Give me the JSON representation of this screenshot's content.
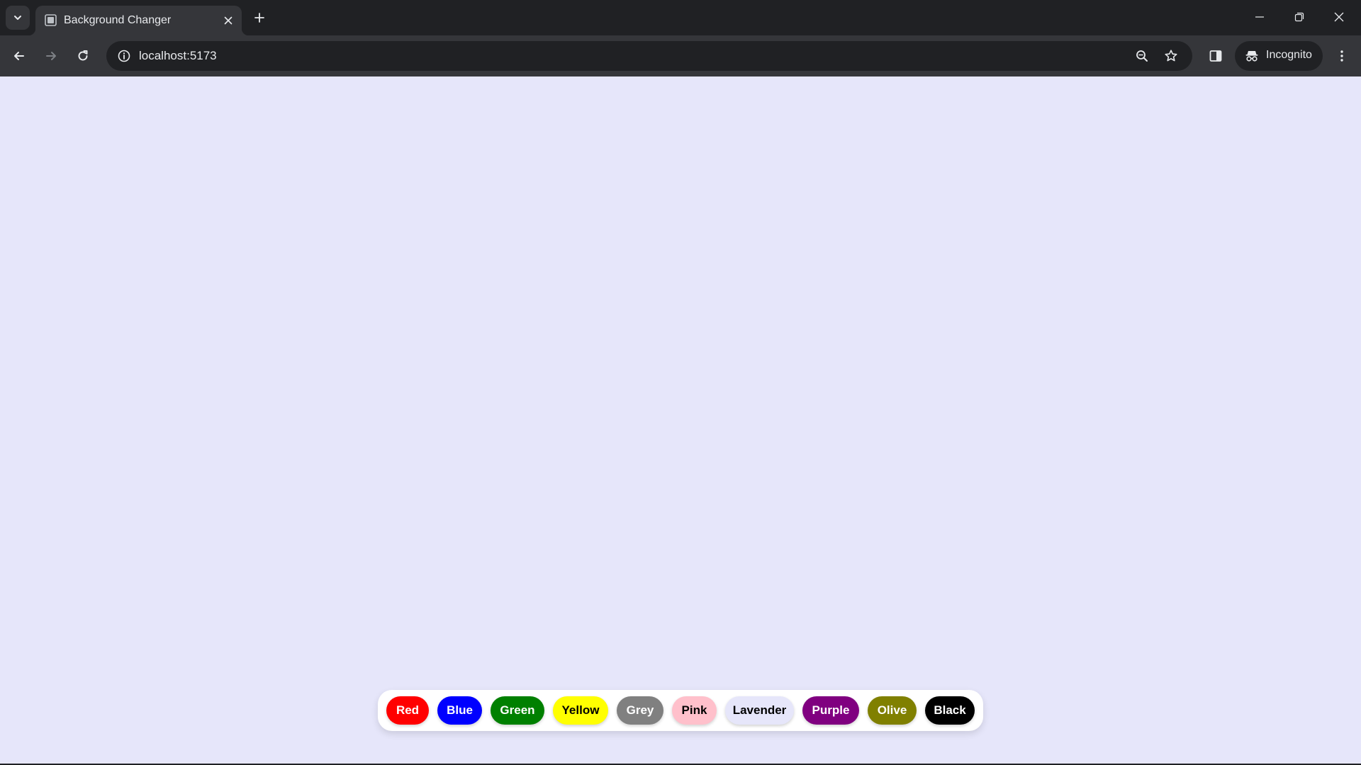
{
  "browser": {
    "tab": {
      "title": "Background Changer"
    },
    "address_bar": {
      "url": "localhost:5173"
    },
    "profile": {
      "label": "Incognito"
    }
  },
  "page": {
    "background_color": "#e6e6fa",
    "color_buttons": [
      {
        "label": "Red",
        "bg": "#ff0000",
        "fg": "#ffffff"
      },
      {
        "label": "Blue",
        "bg": "#0000ff",
        "fg": "#ffffff"
      },
      {
        "label": "Green",
        "bg": "#008000",
        "fg": "#ffffff"
      },
      {
        "label": "Yellow",
        "bg": "#ffff00",
        "fg": "#000000"
      },
      {
        "label": "Grey",
        "bg": "#808080",
        "fg": "#ffffff"
      },
      {
        "label": "Pink",
        "bg": "#ffc0cb",
        "fg": "#000000"
      },
      {
        "label": "Lavender",
        "bg": "#e6e6fa",
        "fg": "#000000"
      },
      {
        "label": "Purple",
        "bg": "#800080",
        "fg": "#ffffff"
      },
      {
        "label": "Olive",
        "bg": "#808000",
        "fg": "#ffffff"
      },
      {
        "label": "Black",
        "bg": "#000000",
        "fg": "#ffffff"
      }
    ]
  }
}
